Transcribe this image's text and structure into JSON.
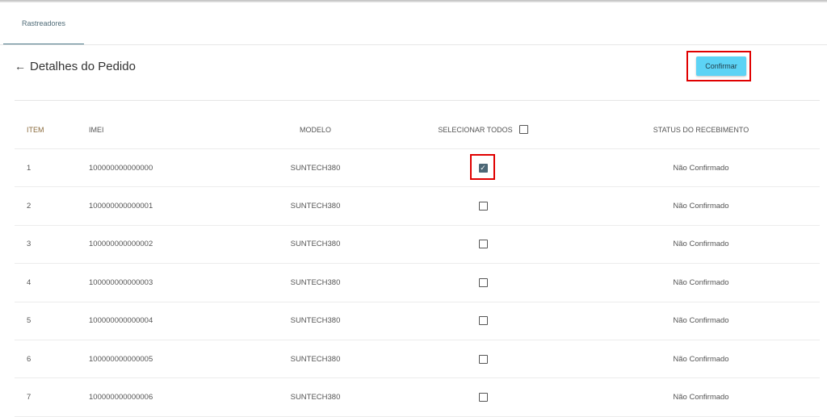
{
  "tabs": [
    {
      "label": "Rastreadores",
      "active": true
    }
  ],
  "header": {
    "back_icon": "←",
    "title": "Detalhes do Pedido"
  },
  "toolbar": {
    "confirm_label": "Confirmar"
  },
  "table": {
    "columns": {
      "item": "ITEM",
      "imei": "IMEI",
      "model": "MODELO",
      "select_all": "SELECIONAR TODOS",
      "status": "STATUS DO RECEBIMENTO"
    },
    "select_all_checked": false,
    "rows": [
      {
        "item": "1",
        "imei": "100000000000000",
        "model": "SUNTECH380",
        "selected": true,
        "status": "Não Confirmado"
      },
      {
        "item": "2",
        "imei": "100000000000001",
        "model": "SUNTECH380",
        "selected": false,
        "status": "Não Confirmado"
      },
      {
        "item": "3",
        "imei": "100000000000002",
        "model": "SUNTECH380",
        "selected": false,
        "status": "Não Confirmado"
      },
      {
        "item": "4",
        "imei": "100000000000003",
        "model": "SUNTECH380",
        "selected": false,
        "status": "Não Confirmado"
      },
      {
        "item": "5",
        "imei": "100000000000004",
        "model": "SUNTECH380",
        "selected": false,
        "status": "Não Confirmado"
      },
      {
        "item": "6",
        "imei": "100000000000005",
        "model": "SUNTECH380",
        "selected": false,
        "status": "Não Confirmado"
      },
      {
        "item": "7",
        "imei": "100000000000006",
        "model": "SUNTECH380",
        "selected": false,
        "status": "Não Confirmado"
      }
    ]
  },
  "colors": {
    "accent": "#5cd3f5",
    "highlight": "#e00000",
    "checkbox_checked": "#4d6877"
  }
}
